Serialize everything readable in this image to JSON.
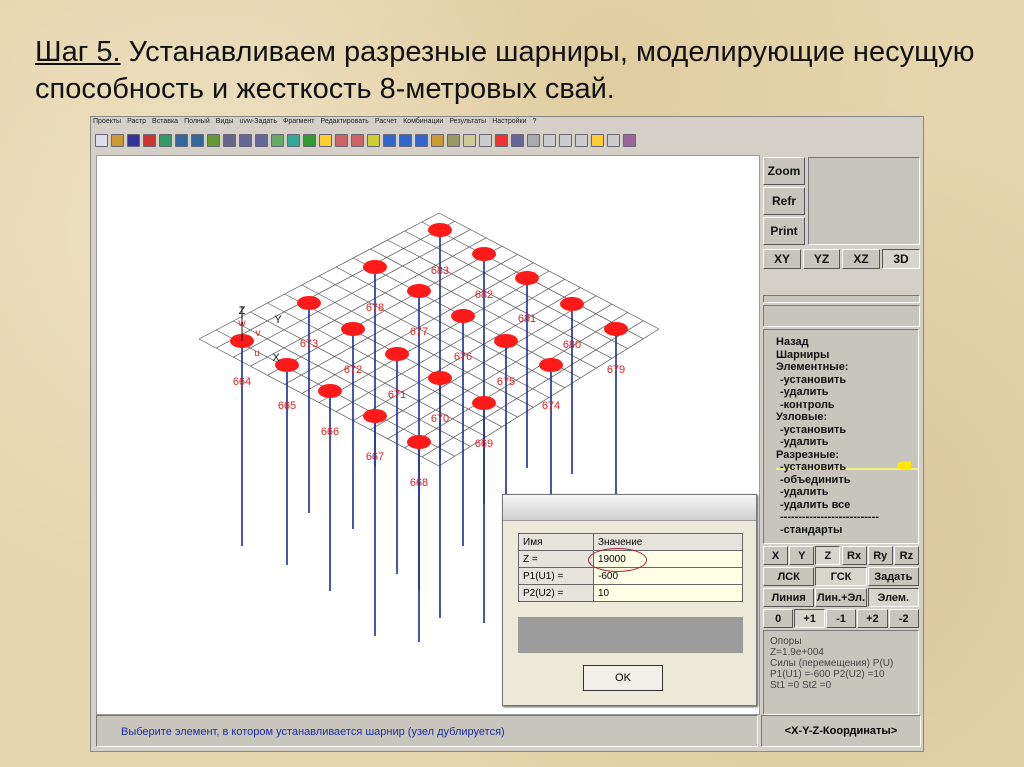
{
  "slide": {
    "step": "Шаг 5.",
    "title": " Устанавливаем разрезные шарниры, моделирующие несущую способность и жесткость 8-метровых свай."
  },
  "menu": [
    "Проекты",
    "Растр",
    "Вставка",
    "Полный",
    "Виды",
    "uvw-Задать",
    "Фрагмент",
    "Редактировать",
    "Расчет",
    "Комбинации",
    "Результаты",
    "Настройки",
    "?"
  ],
  "view_buttons": {
    "zoom": "Zoom",
    "refr": "Refr",
    "print": "Print",
    "xy": "XY",
    "yz": "YZ",
    "xz": "XZ",
    "d3": "3D"
  },
  "side_menu": [
    "Назад",
    "Шарниры",
    "Элементные:",
    "-установить",
    "-удалить",
    "-контроль",
    "Узловые:",
    "-установить",
    "-удалить",
    "Разрезные:",
    "-установить",
    "-объединить",
    "-удалить",
    "-удалить все",
    "---------------------------",
    "-стандарты"
  ],
  "axis_buttons": [
    "X",
    "Y",
    "Z",
    "Rx",
    "Ry",
    "Rz"
  ],
  "cs_buttons": [
    "ЛСК",
    "ГСК",
    "Задать"
  ],
  "mode_buttons": [
    "Линия",
    "Лин.+Эл.",
    "Элем."
  ],
  "step_buttons": [
    "0",
    "+1",
    "-1",
    "+2",
    "-2"
  ],
  "info": [
    "Опоры",
    "Z=1.9e+004",
    "Силы (перемещения) P(U)",
    "P1(U1) =-600   P2(U2) =10",
    "St1 =0      St2 =0"
  ],
  "status": "Выберите элемент, в котором устанавливается шарнир (узел дублируется)",
  "coords": "<X-Y-Z-Координаты>",
  "dialog": {
    "col_name": "Имя",
    "col_value": "Значение",
    "rows": [
      {
        "name": "Z =",
        "value": "19000"
      },
      {
        "name": "P1(U1) =",
        "value": "-600"
      },
      {
        "name": "P2(U2) =",
        "value": "10"
      }
    ],
    "ok": "OK"
  },
  "axes": {
    "z": "Z",
    "y": "Y",
    "x": "X",
    "w": "w",
    "v": "v",
    "u": "u"
  },
  "pile_labels": [
    "683",
    "682",
    "678",
    "681",
    "677",
    "673",
    "680",
    "676",
    "672",
    "679",
    "664",
    "671",
    "675",
    "665",
    "674",
    "670",
    "666",
    "669",
    "667",
    "668"
  ],
  "colors": {
    "hinge": "#ff1a1a",
    "pile": "#1c2a9c",
    "label": "#e02020"
  }
}
